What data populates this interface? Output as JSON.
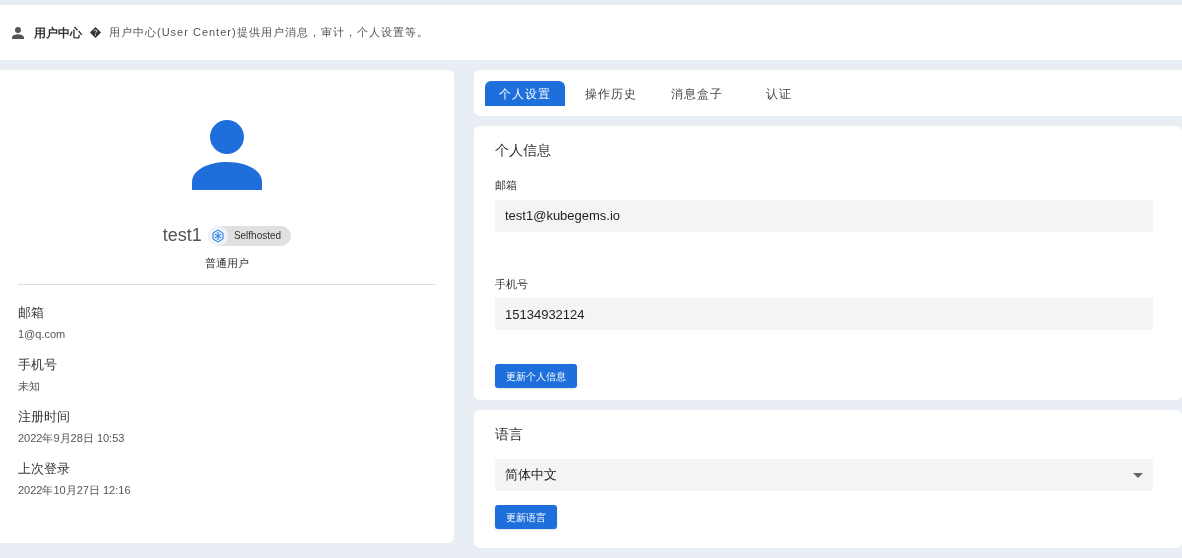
{
  "header": {
    "title": "用户中心",
    "description": "用户中心(User Center)提供用户消息，审计，个人设置等。"
  },
  "profile": {
    "username": "test1",
    "badge": "Selfhosted",
    "role": "普通用户",
    "fields": [
      {
        "label": "邮箱",
        "value": "1@q.com"
      },
      {
        "label": "手机号",
        "value": "未知"
      },
      {
        "label": "注册时间",
        "value": "2022年9月28日 10:53"
      },
      {
        "label": "上次登录",
        "value": "2022年10月27日 12:16"
      }
    ]
  },
  "tabs": [
    {
      "label": "个人设置",
      "selected": true
    },
    {
      "label": "操作历史",
      "selected": false
    },
    {
      "label": "消息盒子",
      "selected": false
    },
    {
      "label": "认证",
      "selected": false
    }
  ],
  "personal_info": {
    "title": "个人信息",
    "fields": [
      {
        "label": "邮箱",
        "value": "test1@kubegems.io"
      },
      {
        "label": "手机号",
        "value": "15134932124"
      }
    ],
    "button": "更新个人信息"
  },
  "language": {
    "title": "语言",
    "value": "简体中文",
    "button": "更新语言"
  }
}
